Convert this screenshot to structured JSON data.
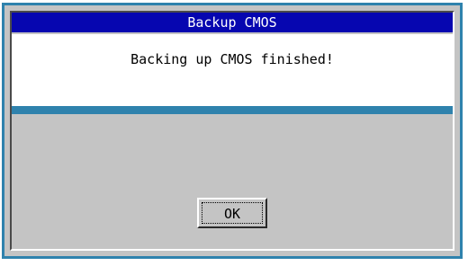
{
  "dialog": {
    "title": "Backup CMOS",
    "message": "Backing up CMOS finished!",
    "ok_label": "OK"
  },
  "colors": {
    "titlebar": "#0606b0",
    "accent": "#2f82ad",
    "background": "#c4c4c4"
  }
}
